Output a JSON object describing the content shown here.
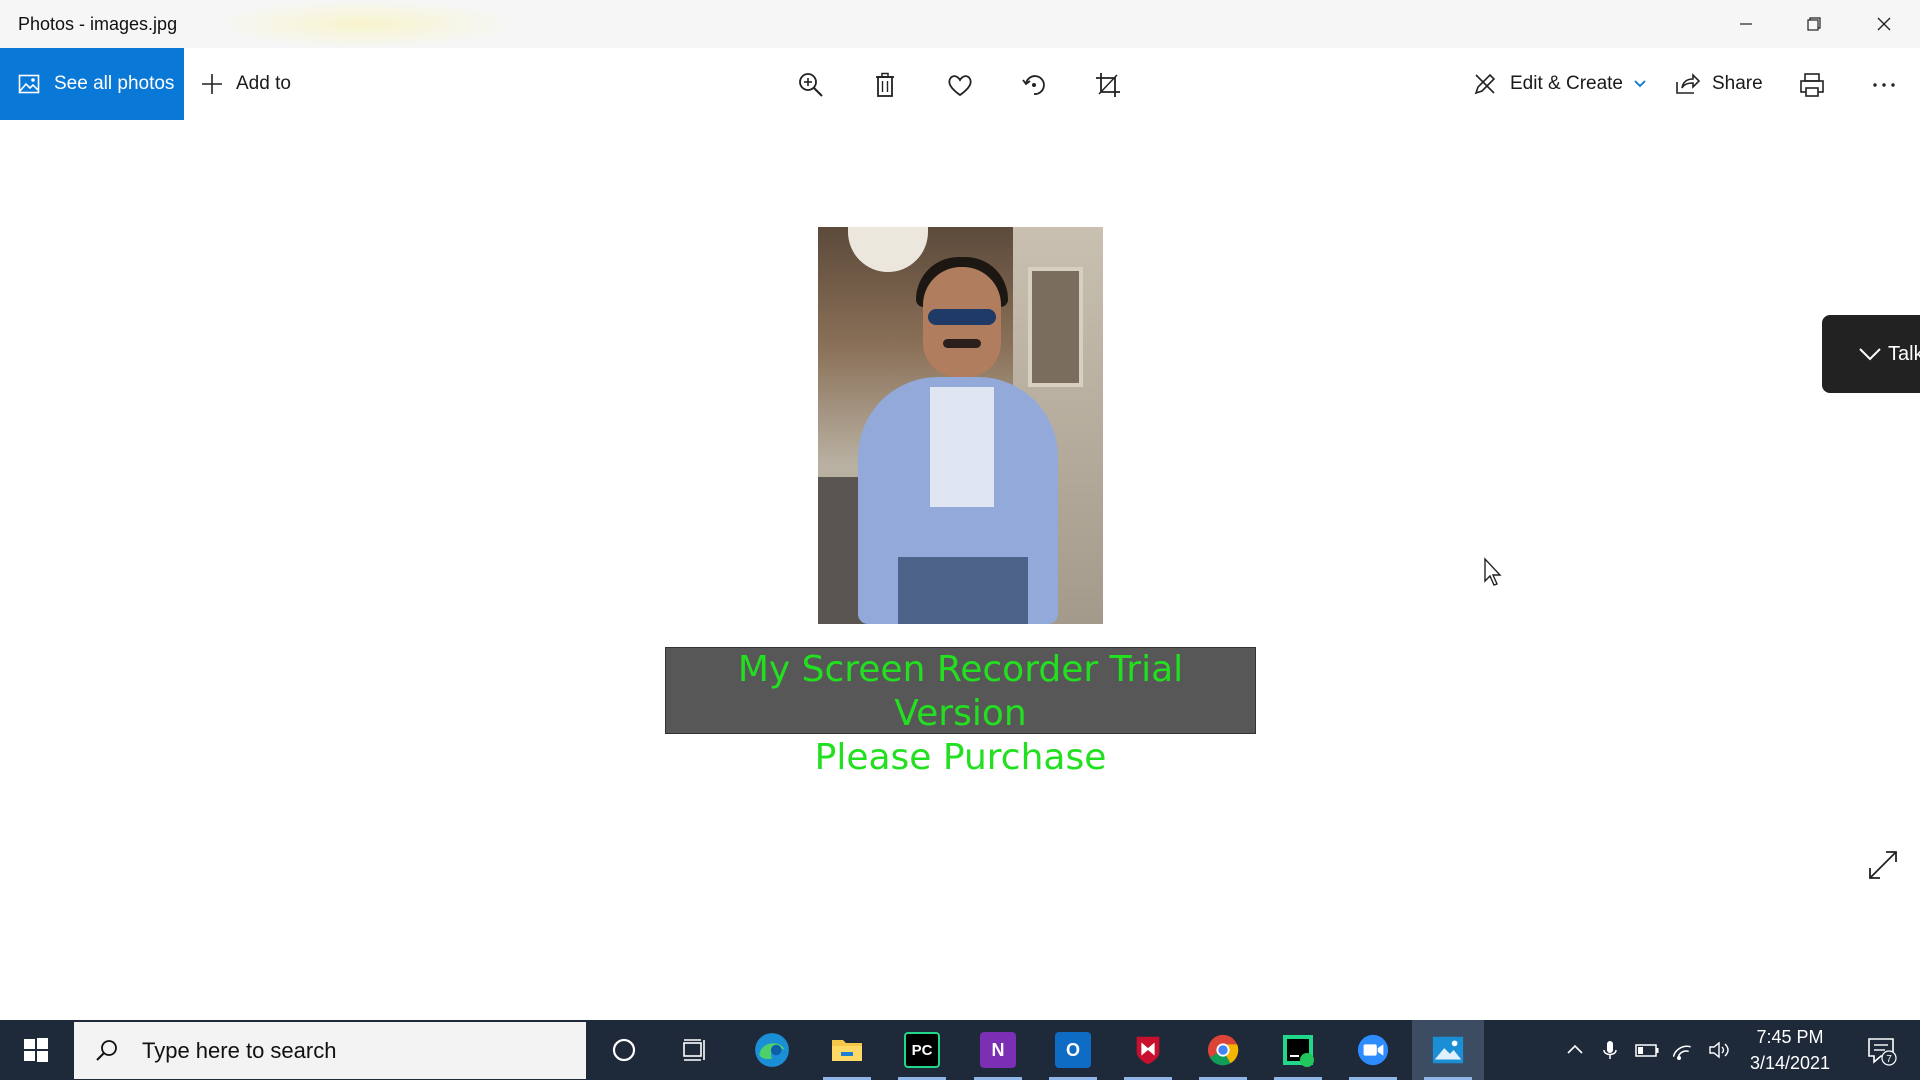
{
  "window": {
    "title": "Photos - images.jpg"
  },
  "toolbar": {
    "see_all_label": "See all photos",
    "add_to_label": "Add to",
    "edit_create_label": "Edit & Create",
    "share_label": "Share",
    "accent_color": "#0a78d7"
  },
  "viewer": {
    "watermark_line1": "My Screen Recorder Trial Version",
    "watermark_line2": "Please Purchase",
    "watermark_text_color": "#22e01f",
    "talk_label": "Talk"
  },
  "taskbar": {
    "search_placeholder": "Type here to search",
    "apps": [
      "cortana-icon",
      "task-view-icon",
      "edge-icon",
      "file-explorer-icon",
      "pycharm-icon",
      "onenote-icon",
      "outlook-icon",
      "mcafee-icon",
      "chrome-icon",
      "pycharm-ce-icon",
      "zoom-icon",
      "photos-icon"
    ],
    "pycharm_letters": "PC",
    "onenote_letter": "N",
    "outlook_letter": "O",
    "time": "7:45 PM",
    "date": "3/14/2021",
    "notification_count": "7"
  }
}
